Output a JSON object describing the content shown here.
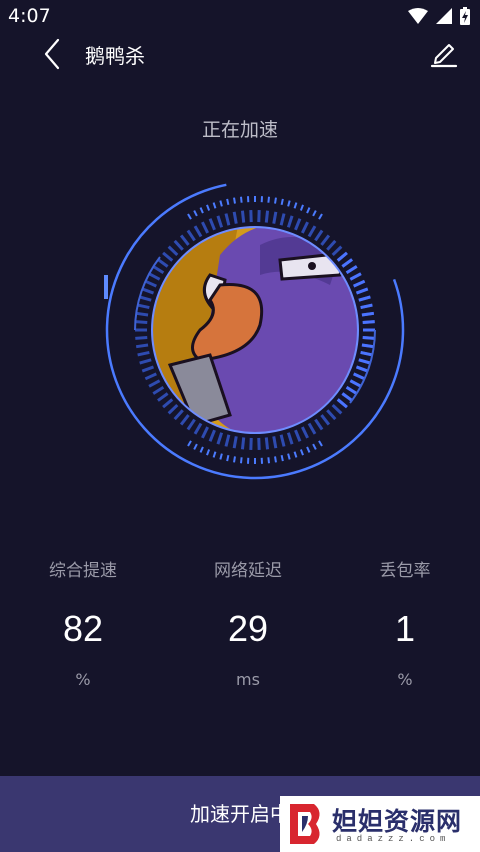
{
  "status_bar": {
    "time": "4:07"
  },
  "header": {
    "title": "鹅鸭杀"
  },
  "status_text": "正在加速",
  "stats": [
    {
      "label": "综合提速",
      "value": "82",
      "unit": "%"
    },
    {
      "label": "网络延迟",
      "value": "29",
      "unit": "ms"
    },
    {
      "label": "丢包率",
      "value": "1",
      "unit": "%"
    }
  ],
  "bottom_button": {
    "label": "加速开启中"
  },
  "watermark": {
    "text": "妲妲资源网",
    "url": "dadazzz.com"
  },
  "colors": {
    "background": "#15142a",
    "accent_ring": "#4b7bff",
    "button": "#3a3770"
  }
}
